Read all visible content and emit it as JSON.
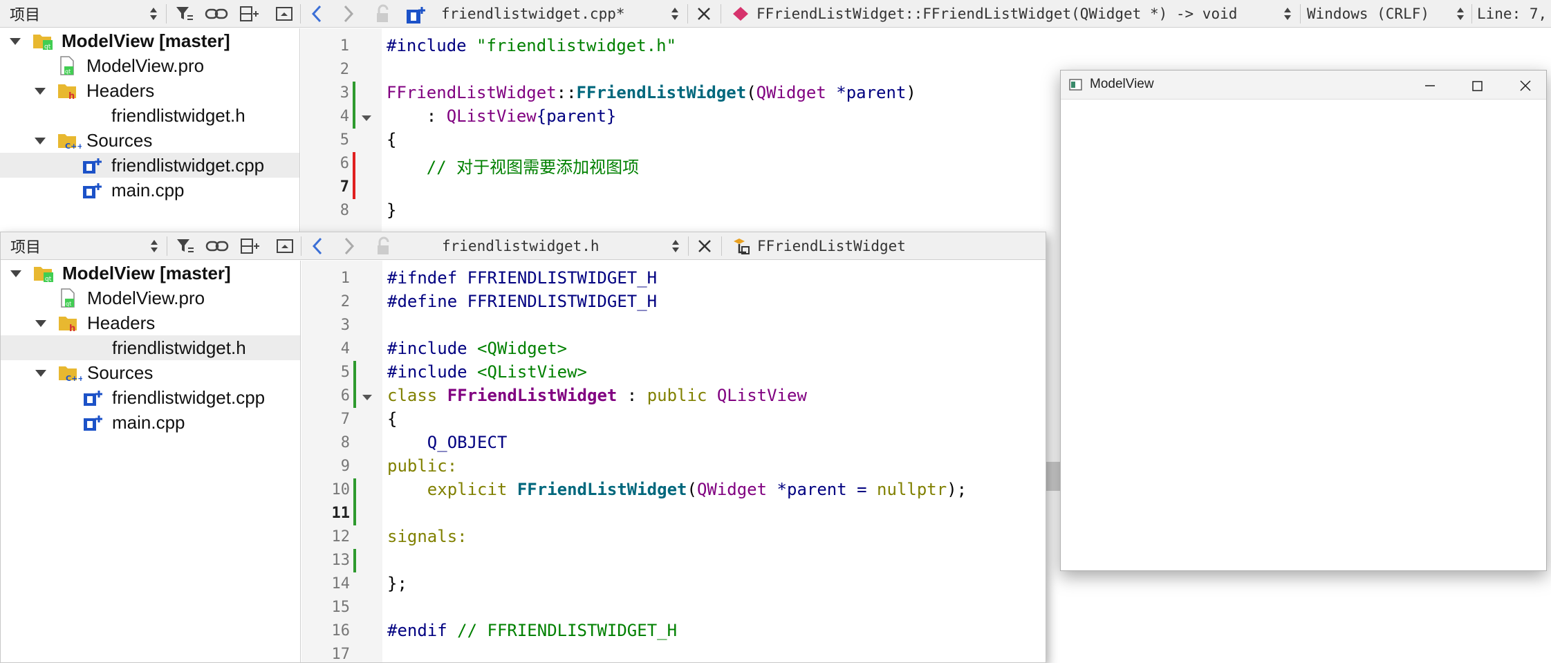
{
  "top_window": {
    "panel_title": "项目",
    "tab_file": "friendlistwidget.cpp*",
    "symbol": "FFriendListWidget::FFriendListWidget(QWidget *) -> void",
    "line_ending": "Windows (CRLF)",
    "line_col": "Line: 7,",
    "tree": {
      "project": "ModelView [master]",
      "pro_file": "ModelView.pro",
      "headers": "Headers",
      "header_file": "friendlistwidget.h",
      "sources": "Sources",
      "source_cpp": "friendlistwidget.cpp",
      "source_main": "main.cpp"
    },
    "line_numbers": [
      "1",
      "2",
      "3",
      "4",
      "5",
      "6",
      "7",
      "8"
    ],
    "code": {
      "l1_a": "#include ",
      "l1_b": "\"friendlistwidget.h\"",
      "l3_cls": "FFriendListWidget",
      "l3_sep": "::",
      "l3_fn": "FFriendListWidget",
      "l3_paren": "(",
      "l3_type": "QWidget",
      "l3_param": " *parent",
      "l3_close": ")",
      "l4_a": "    : ",
      "l4_type": "QListView",
      "l4_b": "{parent}",
      "l5": "{",
      "l6": "    // 对于视图需要添加视图项",
      "l8": "}"
    }
  },
  "bottom_window": {
    "panel_title": "项目",
    "tab_file": "friendlistwidget.h",
    "symbol": "FFriendListWidget",
    "tree": {
      "project": "ModelView [master]",
      "pro_file": "ModelView.pro",
      "headers": "Headers",
      "header_file": "friendlistwidget.h",
      "sources": "Sources",
      "source_cpp": "friendlistwidget.cpp",
      "source_main": "main.cpp"
    },
    "line_numbers": [
      "1",
      "2",
      "3",
      "4",
      "5",
      "6",
      "7",
      "8",
      "9",
      "10",
      "11",
      "12",
      "13",
      "14",
      "15",
      "16",
      "17"
    ],
    "code": {
      "l1_a": "#ifndef ",
      "l1_b": "FFRIENDLISTWIDGET_H",
      "l2_a": "#define ",
      "l2_b": "FFRIENDLISTWIDGET_H",
      "l4_a": "#include ",
      "l4_b": "<QWidget>",
      "l5_a": "#include ",
      "l5_b": "<QListView>",
      "l6_kw": "class ",
      "l6_cls": "FFriendListWidget",
      "l6_mid": " : ",
      "l6_pub": "public ",
      "l6_base": "QListView",
      "l7": "{",
      "l8": "    Q_OBJECT",
      "l9": "public:",
      "l10_a": "    explicit ",
      "l10_fn": "FFriendListWidget",
      "l10_paren": "(",
      "l10_type": "QWidget",
      "l10_param": " *parent = ",
      "l10_null": "nullptr",
      "l10_end": ");",
      "l12": "signals:",
      "l14": "};",
      "l16_a": "#endif ",
      "l16_b": "// FFRIENDLISTWIDGET_H"
    }
  },
  "model_window": {
    "title": "ModelView"
  },
  "colors": {
    "accent_blue": "#3b6fd6",
    "change_green": "#2e9a2e",
    "change_red": "#e02020"
  }
}
